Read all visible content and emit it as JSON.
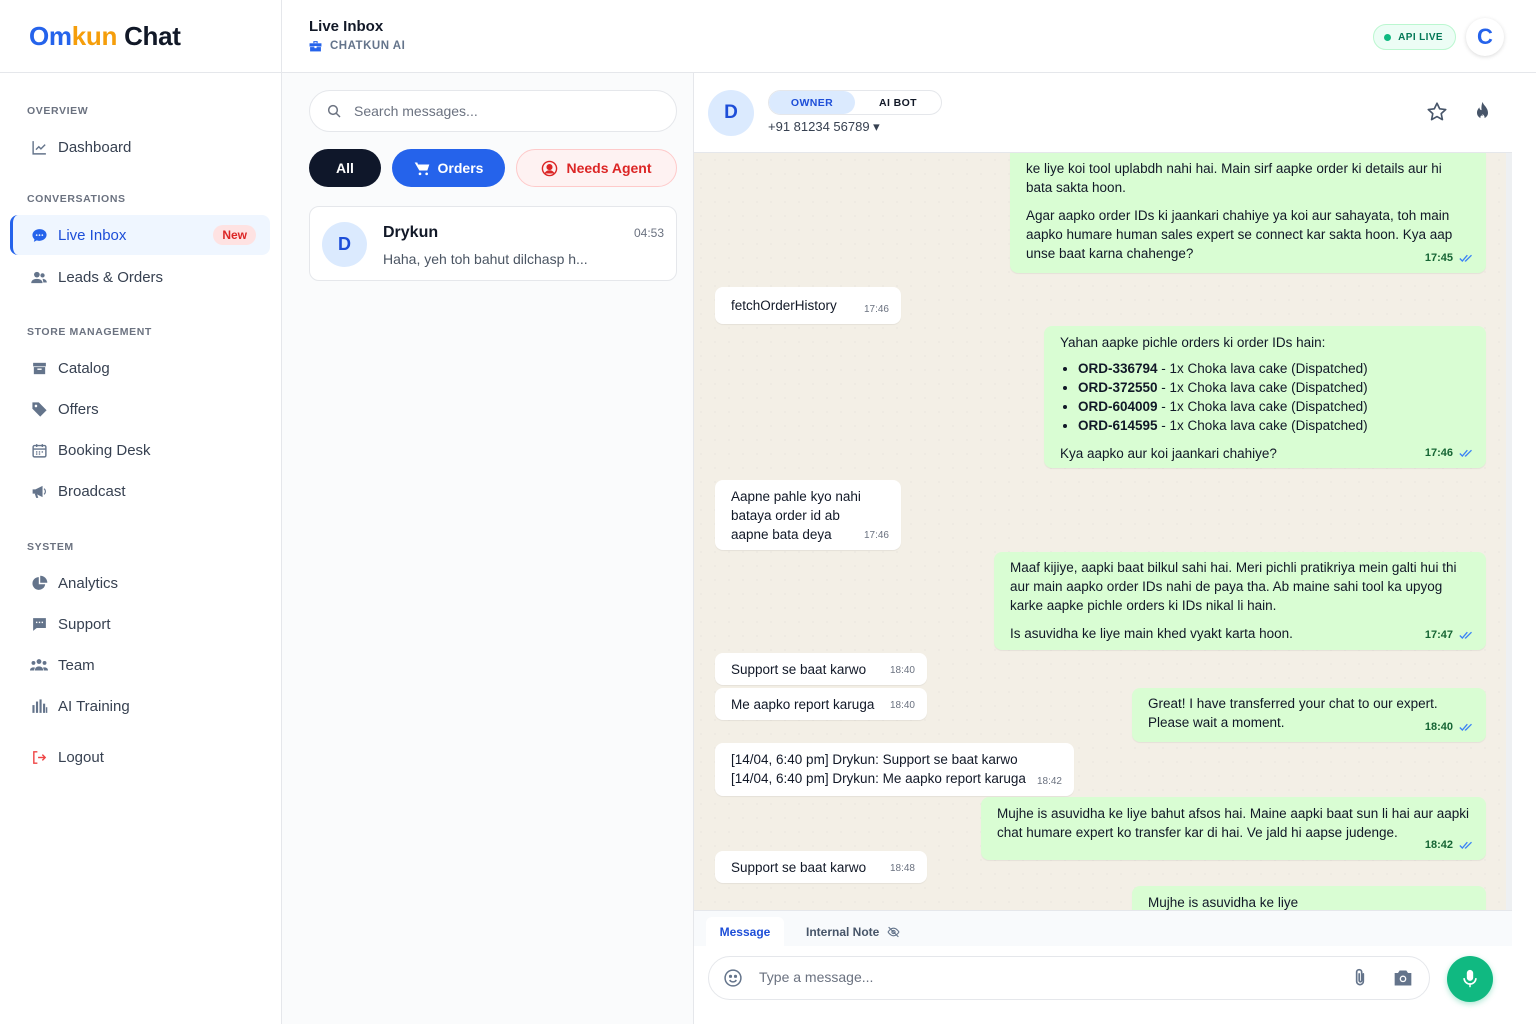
{
  "brand": {
    "part1": "Om",
    "part2": "kun",
    "part3": "Chat"
  },
  "sidebar": {
    "sections": [
      {
        "label": "OVERVIEW"
      },
      {
        "label": "CONVERSATIONS"
      },
      {
        "label": "STORE MANAGEMENT"
      },
      {
        "label": "SYSTEM"
      }
    ],
    "items": [
      {
        "label": "Dashboard",
        "icon": "chart-line-icon"
      },
      {
        "label": "Live Inbox",
        "icon": "chat-bubble-icon",
        "badge": "New",
        "active": true
      },
      {
        "label": "Leads & Orders",
        "icon": "users-icon"
      },
      {
        "label": "Catalog",
        "icon": "box-icon"
      },
      {
        "label": "Offers",
        "icon": "tag-icon"
      },
      {
        "label": "Booking Desk",
        "icon": "calendar-icon"
      },
      {
        "label": "Broadcast",
        "icon": "megaphone-icon"
      },
      {
        "label": "Analytics",
        "icon": "pie-chart-icon"
      },
      {
        "label": "Support",
        "icon": "message-square-icon"
      },
      {
        "label": "Team",
        "icon": "team-icon"
      },
      {
        "label": "AI Training",
        "icon": "bar-chart-icon"
      },
      {
        "label": "Logout",
        "icon": "logout-icon"
      }
    ]
  },
  "header": {
    "title": "Live Inbox",
    "subtitle": "CHATKUN AI",
    "status": "API LIVE",
    "avatar_initial": "C"
  },
  "conversations": {
    "search_placeholder": "Search messages...",
    "filters": {
      "all": "All",
      "orders": "Orders",
      "needs_agent": "Needs Agent"
    },
    "items": [
      {
        "initial": "D",
        "name": "Drykun",
        "time": "04:53",
        "preview": "Haha, yeh toh bahut dilchasp h..."
      }
    ]
  },
  "chat": {
    "contact_initial": "D",
    "mode_owner": "OWNER",
    "mode_ai": "AI BOT",
    "phone": "+91 81234 56789 ▾",
    "messages": [
      {
        "dir": "out",
        "paras": [
          "ke liye koi tool uplabdh nahi hai. Main sirf aapke order ki details aur hi bata sakta hoon.",
          "Agar aapko order IDs ki jaankari chahiye ya koi aur sahayata, toh main aapko humare human sales expert se connect kar sakta hoon. Kya aap unse baat karna chahenge?"
        ],
        "time": "17:45"
      },
      {
        "dir": "in",
        "text": "fetchOrderHistory",
        "time": "17:46"
      },
      {
        "dir": "out",
        "intro": "Yahan aapke pichle orders ki order IDs hain:",
        "orders": [
          {
            "id": "ORD-336794",
            "desc": " - 1x Choka lava cake (Dispatched)"
          },
          {
            "id": "ORD-372550",
            "desc": " - 1x Choka lava cake (Dispatched)"
          },
          {
            "id": "ORD-604009",
            "desc": " - 1x Choka lava cake (Dispatched)"
          },
          {
            "id": "ORD-614595",
            "desc": " - 1x Choka lava cake (Dispatched)"
          }
        ],
        "outro": "Kya aapko aur koi jaankari chahiye?",
        "time": "17:46"
      },
      {
        "dir": "in",
        "text": "Aapne pahle kyo nahi bataya order id ab aapne bata deya",
        "time": "17:46"
      },
      {
        "dir": "out",
        "paras": [
          "Maaf kijiye, aapki baat bilkul sahi hai. Meri pichli pratikriya mein galti hui thi aur main aapko order IDs nahi de paya tha. Ab maine sahi tool ka upyog karke aapke pichle orders ki IDs nikal li hain.",
          "Is asuvidha ke liye main khed vyakt karta hoon."
        ],
        "time": "17:47"
      },
      {
        "dir": "in",
        "text": "Support se baat karwo",
        "time": "18:40"
      },
      {
        "dir": "in",
        "text": "Me aapko report karuga",
        "time": "18:40"
      },
      {
        "dir": "out",
        "paras": [
          "Great! I have transferred your chat to our expert. Please wait a moment."
        ],
        "time": "18:40"
      },
      {
        "dir": "in",
        "lines": [
          "[14/04, 6:40 pm] Drykun: Support se baat karwo",
          "[14/04, 6:40 pm] Drykun: Me aapko report karuga"
        ],
        "time": "18:42"
      },
      {
        "dir": "out",
        "paras": [
          "Mujhe is asuvidha ke liye bahut afsos hai. Maine aapki baat sun li hai aur aapki chat humare expert ko transfer kar di hai. Ve jald hi aapse judenge."
        ],
        "time": "18:42"
      },
      {
        "dir": "in",
        "text": "Support se baat karwo",
        "time": "18:48"
      },
      {
        "dir": "out",
        "paras": [
          "Mujhe is asuvidha ke liye"
        ],
        "time": ""
      }
    ]
  },
  "composer": {
    "tab_message": "Message",
    "tab_note": "Internal Note",
    "placeholder": "Type a message..."
  },
  "colors": {
    "accent": "#2563eb",
    "brand_secondary": "#f59e0b",
    "outgoing_bubble": "#d9fdd3",
    "live_green": "#10b981",
    "danger": "#dc2626"
  }
}
